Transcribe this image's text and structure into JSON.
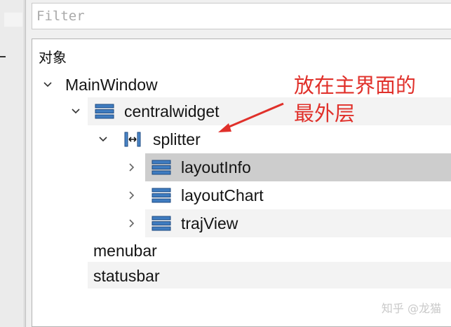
{
  "filter": {
    "placeholder": "Filter"
  },
  "tree": {
    "header": "对象",
    "items": [
      {
        "label": "MainWindow",
        "expanded": true,
        "icon": ""
      },
      {
        "label": "centralwidget",
        "expanded": true,
        "icon": "layout-widget-icon"
      },
      {
        "label": "splitter",
        "expanded": true,
        "icon": "horizontal-splitter-icon"
      },
      {
        "label": "layoutInfo",
        "expanded": false,
        "icon": "layout-widget-icon",
        "selected": true
      },
      {
        "label": "layoutChart",
        "expanded": false,
        "icon": "layout-widget-icon"
      },
      {
        "label": "trajView",
        "expanded": false,
        "icon": "layout-widget-icon"
      },
      {
        "label": "menubar"
      },
      {
        "label": "statusbar"
      }
    ]
  },
  "annotation": {
    "line1": "放在主界面的",
    "line2": "最外层",
    "color": "#e0302a"
  },
  "watermark": "知乎 @龙猫"
}
